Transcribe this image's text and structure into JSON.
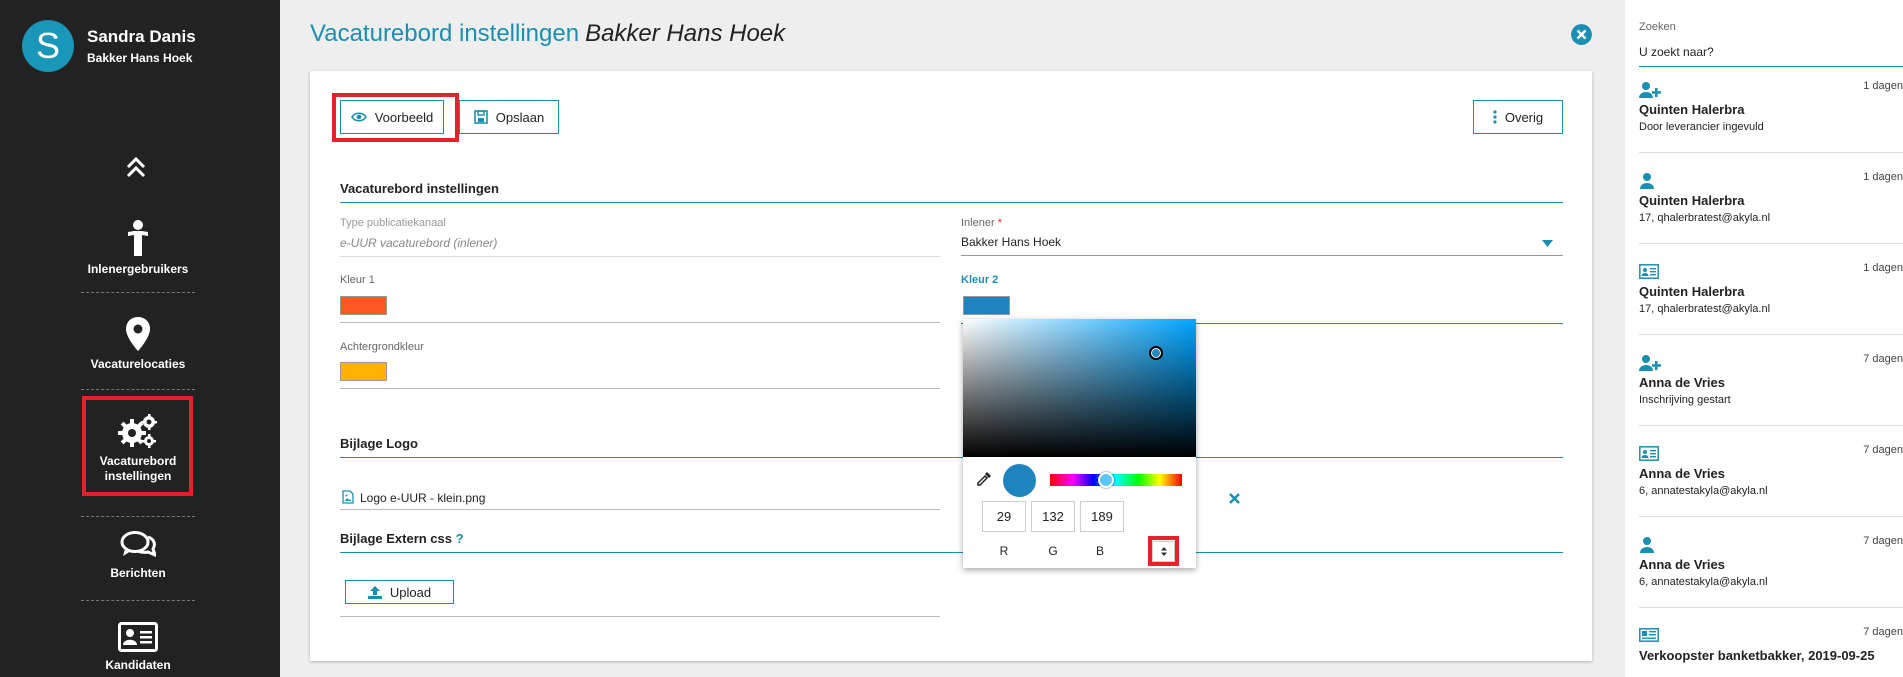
{
  "user": {
    "initial": "S",
    "name": "Sandra Danis",
    "company": "Bakker Hans Hoek"
  },
  "nav": {
    "items": [
      {
        "label": "Inlenergebruikers",
        "icon": "person-icon"
      },
      {
        "label": "Vacaturelocaties",
        "icon": "location-pin-icon"
      },
      {
        "label": "Vacaturebord instellingen",
        "icon": "gears-icon",
        "active": true
      },
      {
        "label": "Berichten",
        "icon": "chat-bubbles-icon"
      },
      {
        "label": "Kandidaten",
        "icon": "id-card-icon"
      }
    ]
  },
  "header": {
    "title": "Vacaturebord instellingen",
    "subtitle": "Bakker Hans Hoek"
  },
  "toolbar": {
    "preview_label": "Voorbeeld",
    "save_label": "Opslaan",
    "more_label": "Overig"
  },
  "settings": {
    "section_title": "Vacaturebord instellingen",
    "publication_channel": {
      "label": "Type publicatiekanaal",
      "value": "e-UUR vacaturebord (inlener)"
    },
    "inlener": {
      "label": "Inlener",
      "required_mark": "*",
      "value": "Bakker Hans Hoek"
    },
    "color1": {
      "label": "Kleur 1",
      "value": "#ff5722"
    },
    "color2": {
      "label": "Kleur 2",
      "value": "#1d84bd"
    },
    "background_color": {
      "label": "Achtergrondkleur",
      "value": "#ffb300"
    }
  },
  "logo": {
    "section_title": "Bijlage Logo",
    "file_name": "Logo e-UUR - klein.png"
  },
  "css": {
    "section_title": "Bijlage Extern css",
    "help": "?",
    "upload_label": "Upload"
  },
  "color_picker": {
    "r": "29",
    "g": "132",
    "b": "189",
    "r_label": "R",
    "g_label": "G",
    "b_label": "B",
    "hue_color": "#00a5ff"
  },
  "search": {
    "label": "Zoeken",
    "placeholder": "U zoekt naar?"
  },
  "feed": [
    {
      "icon": "user-plus-icon",
      "days": "1 dagen",
      "name": "Quinten Halerbra",
      "sub": "Door leverancier ingevuld"
    },
    {
      "icon": "user-icon",
      "days": "1 dagen",
      "name": "Quinten Halerbra",
      "sub": "17, qhalerbratest@akyla.nl"
    },
    {
      "icon": "id-card-icon",
      "days": "1 dagen",
      "name": "Quinten Halerbra",
      "sub": "17, qhalerbratest@akyla.nl"
    },
    {
      "icon": "user-plus-icon",
      "days": "7 dagen",
      "name": "Anna de Vries",
      "sub": "Inschrijving gestart"
    },
    {
      "icon": "id-card-icon",
      "days": "7 dagen",
      "name": "Anna de Vries",
      "sub": "6, annatestakyla@akyla.nl"
    },
    {
      "icon": "user-icon",
      "days": "7 dagen",
      "name": "Anna de Vries",
      "sub": "6, annatestakyla@akyla.nl"
    },
    {
      "icon": "newspaper-icon",
      "days": "7 dagen",
      "name": "Verkoopster banketbakker, 2019-09-25",
      "sub": ""
    }
  ],
  "colors": {
    "accent": "#1a8fb0",
    "sidebar": "#222222",
    "highlight": "#e4222c"
  }
}
